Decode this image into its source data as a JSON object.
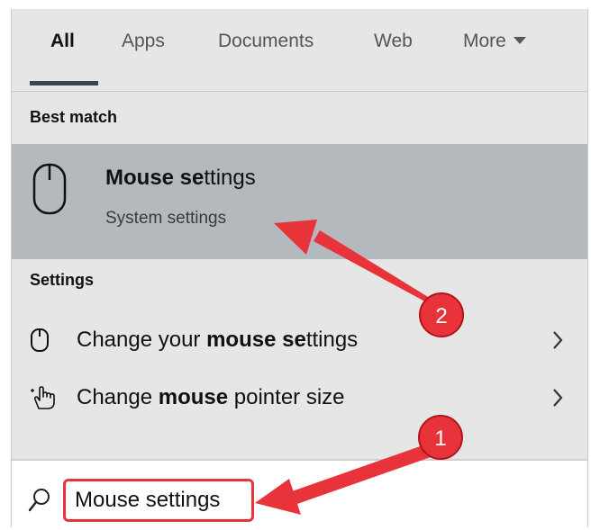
{
  "tabs": [
    {
      "label": "All",
      "active": true
    },
    {
      "label": "Apps"
    },
    {
      "label": "Documents"
    },
    {
      "label": "Web"
    },
    {
      "label": "More"
    }
  ],
  "best_match": {
    "header": "Best match",
    "title_bold": "Mouse se",
    "title_rest": "ttings",
    "subtitle": "System settings",
    "icon": "mouse-icon"
  },
  "settings": {
    "header": "Settings",
    "items": [
      {
        "pre": "Change your ",
        "bold": "mouse se",
        "post": "ttings",
        "icon": "mouse-icon"
      },
      {
        "pre": "Change ",
        "bold": "mouse",
        "post": " pointer size",
        "icon": "pointer-hand-icon"
      }
    ]
  },
  "search": {
    "value": "Mouse settings",
    "icon": "search-icon"
  },
  "annotations": [
    {
      "number": "1"
    },
    {
      "number": "2"
    }
  ],
  "colors": {
    "panel_bg": "#e6e6e6",
    "highlight_bg": "#b4b9bd",
    "annotation_red": "#e8333a"
  }
}
